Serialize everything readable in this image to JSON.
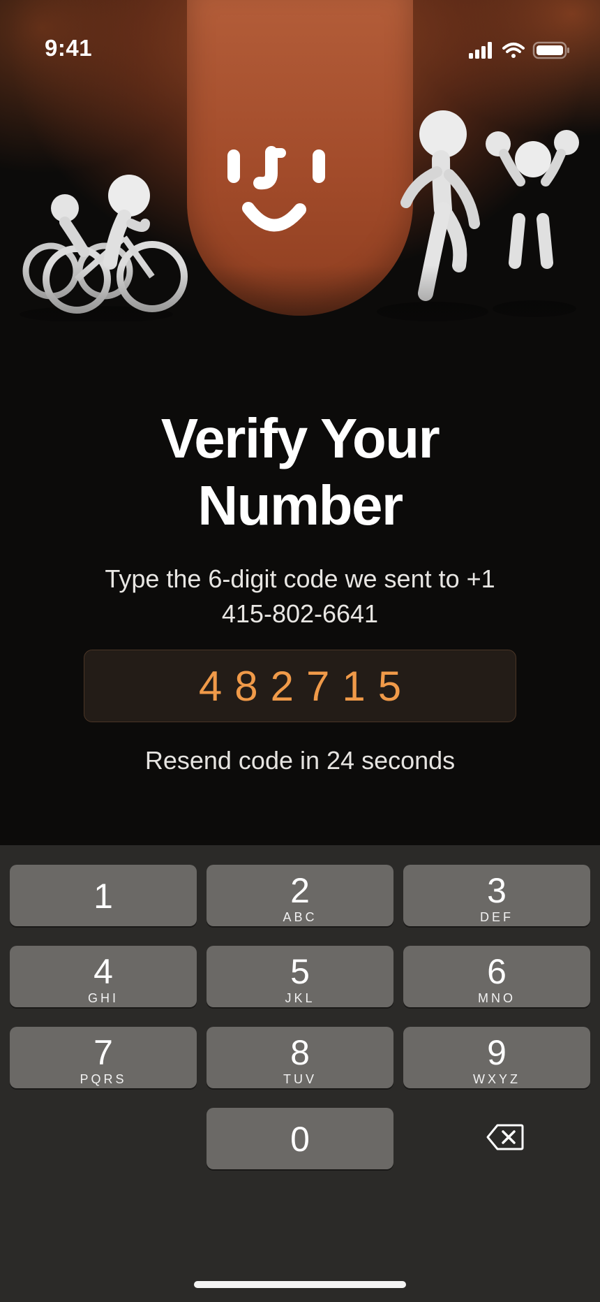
{
  "status_bar": {
    "time": "9:41",
    "icons": [
      "cellular-signal-icon",
      "wifi-icon",
      "battery-icon"
    ]
  },
  "hero": {
    "illustration": [
      "mascot-smiley",
      "cyclist-figure",
      "walking-figure",
      "jumping-figure"
    ],
    "accent_color": "#a8502c"
  },
  "title": "Verify Your Number",
  "subtitle": "Type the 6-digit code we sent to +1 415-802-6641",
  "code_input": {
    "value": "482715",
    "accent_color": "#f09a49"
  },
  "resend_text": "Resend code in 24 seconds",
  "keypad": {
    "keys": [
      {
        "digit": "1",
        "letters": ""
      },
      {
        "digit": "2",
        "letters": "ABC"
      },
      {
        "digit": "3",
        "letters": "DEF"
      },
      {
        "digit": "4",
        "letters": "GHI"
      },
      {
        "digit": "5",
        "letters": "JKL"
      },
      {
        "digit": "6",
        "letters": "MNO"
      },
      {
        "digit": "7",
        "letters": "PQRS"
      },
      {
        "digit": "8",
        "letters": "TUV"
      },
      {
        "digit": "9",
        "letters": "WXYZ"
      },
      {
        "digit": "0",
        "letters": ""
      }
    ],
    "backspace_icon": "delete-backspace-icon"
  }
}
